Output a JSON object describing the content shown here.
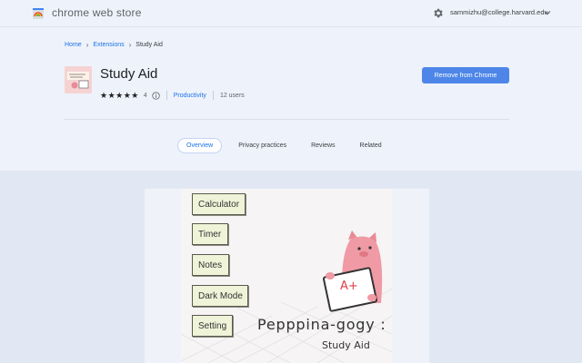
{
  "header": {
    "store_title": "chrome web store",
    "account": "sammizhu@college.harvard.edu"
  },
  "breadcrumb": {
    "home": "Home",
    "extensions": "Extensions",
    "current": "Study Aid"
  },
  "extension": {
    "name": "Study Aid",
    "stars": "★★★★★",
    "rating": "4",
    "category": "Productivity",
    "users": "12 users",
    "remove_label": "Remove from Chrome"
  },
  "tabs": [
    {
      "label": "Overview",
      "active": true
    },
    {
      "label": "Privacy practices",
      "active": false
    },
    {
      "label": "Reviews",
      "active": false
    },
    {
      "label": "Related",
      "active": false
    }
  ],
  "screenshot": {
    "menu": [
      "Calculator",
      "Timer",
      "Notes",
      "Dark Mode",
      "Setting"
    ],
    "brand": "Pepppina-gogy :",
    "brand_sub": "Study Aid",
    "grade": "A+"
  },
  "colors": {
    "accent": "#1a73e8",
    "button": "#4d86e8",
    "pig": "#e88a96"
  },
  "icons": [
    "chrome-web-store-logo-icon",
    "gear-icon",
    "chevron-down-icon",
    "chevron-right-icon",
    "info-icon"
  ]
}
